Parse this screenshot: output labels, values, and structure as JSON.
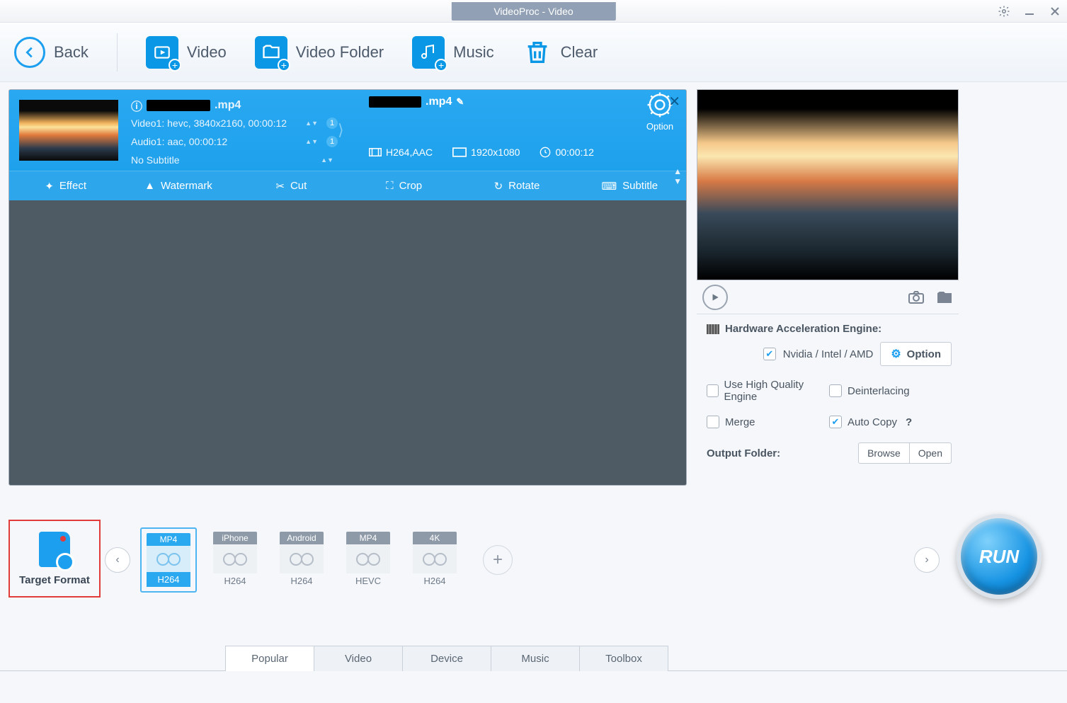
{
  "titlebar": {
    "title": "VideoProc - Video"
  },
  "toolbar": {
    "back": "Back",
    "video": "Video",
    "folder": "Video Folder",
    "music": "Music",
    "clear": "Clear"
  },
  "file": {
    "input_name_ext": ".mp4",
    "video_line": "Video1: hevc, 3840x2160, 00:00:12",
    "audio_line": "Audio1: aac, 00:00:12",
    "subtitle_line": "No Subtitle",
    "badge1": "1",
    "badge2": "1",
    "output_name_ext": ".mp4",
    "output_codec": "H264,AAC",
    "output_res": "1920x1080",
    "output_dur": "00:00:12",
    "option_label": "Option",
    "edit": {
      "effect": "Effect",
      "watermark": "Watermark",
      "cut": "Cut",
      "crop": "Crop",
      "rotate": "Rotate",
      "subtitle": "Subtitle"
    }
  },
  "panel": {
    "hw_title": "Hardware Acceleration Engine:",
    "hw_vendor": "Nvidia / Intel / AMD",
    "hw_option": "Option",
    "high_quality": "Use High Quality Engine",
    "deinterlace": "Deinterlacing",
    "merge": "Merge",
    "autocopy": "Auto Copy",
    "out_folder": "Output Folder:",
    "browse": "Browse",
    "open": "Open"
  },
  "target": {
    "label": "Target Format"
  },
  "formats": [
    {
      "top": "MP4",
      "bot": "H264",
      "sel": true
    },
    {
      "top": "iPhone",
      "bot": "H264",
      "sel": false
    },
    {
      "top": "Android",
      "bot": "H264",
      "sel": false
    },
    {
      "top": "MP4",
      "bot": "HEVC",
      "sel": false
    },
    {
      "top": "4K",
      "bot": "H264",
      "sel": false
    }
  ],
  "tabs": [
    "Popular",
    "Video",
    "Device",
    "Music",
    "Toolbox"
  ],
  "active_tab": "Popular",
  "run": "RUN"
}
